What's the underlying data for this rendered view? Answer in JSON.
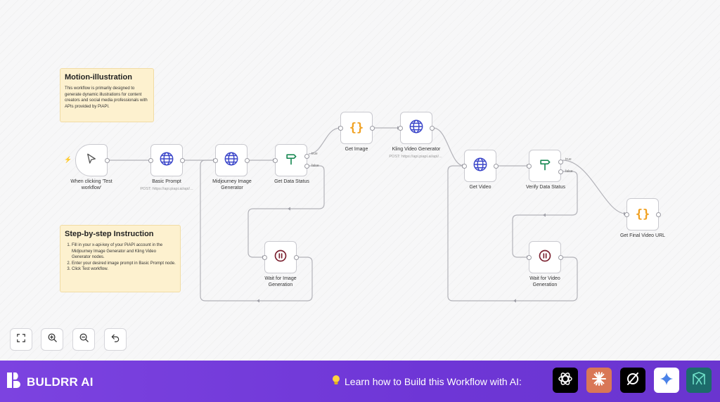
{
  "notes": {
    "motion": {
      "title": "Motion-illustration",
      "body": "This workflow is primarily designed to generate dynamic illustrations for content creators and social media professionals with APIs provided by PiAPI."
    },
    "steps": {
      "title": "Step-by-step Instruction",
      "items": [
        "Fill in your x-api-key of your PiAPI account in the Midjourney Image Generator and Kling Video Generator nodes.",
        "Enter your desired image prompt in Basic Prompt node.",
        "Click Test workflow."
      ]
    }
  },
  "nodes": {
    "trigger": {
      "label": "When clicking 'Test workflow'",
      "icon": "cursor-icon"
    },
    "basic_prompt": {
      "label": "Basic Prompt",
      "sub": "POST: https://api.piapi.ai/api/...",
      "icon": "globe-icon"
    },
    "midjourney": {
      "label": "Midjourney Image Generator",
      "icon": "globe-icon"
    },
    "get_data_status": {
      "label": "Get Data Status",
      "icon": "if-icon",
      "true_label": "true",
      "false_label": "false"
    },
    "get_image": {
      "label": "Get Image",
      "icon": "braces-icon"
    },
    "kling": {
      "label": "Kling Video Generator",
      "sub": "POST: https://api.piapi.ai/api/...",
      "icon": "globe-icon"
    },
    "wait_image": {
      "label": "Wait for Image Generation",
      "icon": "pause-icon"
    },
    "get_video": {
      "label": "Get Video",
      "icon": "globe-icon"
    },
    "verify_status": {
      "label": "Verify Data Status",
      "icon": "if-icon",
      "true_label": "true",
      "false_label": "false"
    },
    "wait_video": {
      "label": "Wait for Video Generation",
      "icon": "pause-icon"
    },
    "final_url": {
      "label": "Get Final Video URL",
      "icon": "braces-icon"
    }
  },
  "controls": [
    "fit-view-icon",
    "zoom-in-icon",
    "zoom-out-icon",
    "undo-icon"
  ],
  "footer": {
    "brand": "BULDRR AI",
    "learn_text": "Learn how to Build this Workflow with AI:",
    "ai_icons": [
      {
        "name": "chatgpt-icon",
        "bg": "#000000"
      },
      {
        "name": "claude-icon",
        "bg": "#d97757"
      },
      {
        "name": "perplexity-icon",
        "bg": "#000000"
      },
      {
        "name": "gemini-icon",
        "bg": "#ffffff"
      },
      {
        "name": "manus-icon",
        "bg": "#1d6b6b"
      }
    ]
  },
  "colors": {
    "accent": "#6e36d6",
    "node_border": "#c9c9cf",
    "note_bg": "#fdf1cf",
    "globe": "#3b46c9",
    "if_green": "#1b8a55",
    "braces_orange": "#f0a020",
    "pause_red": "#7a1f2e",
    "trigger_bolt": "#ff6d5a"
  }
}
